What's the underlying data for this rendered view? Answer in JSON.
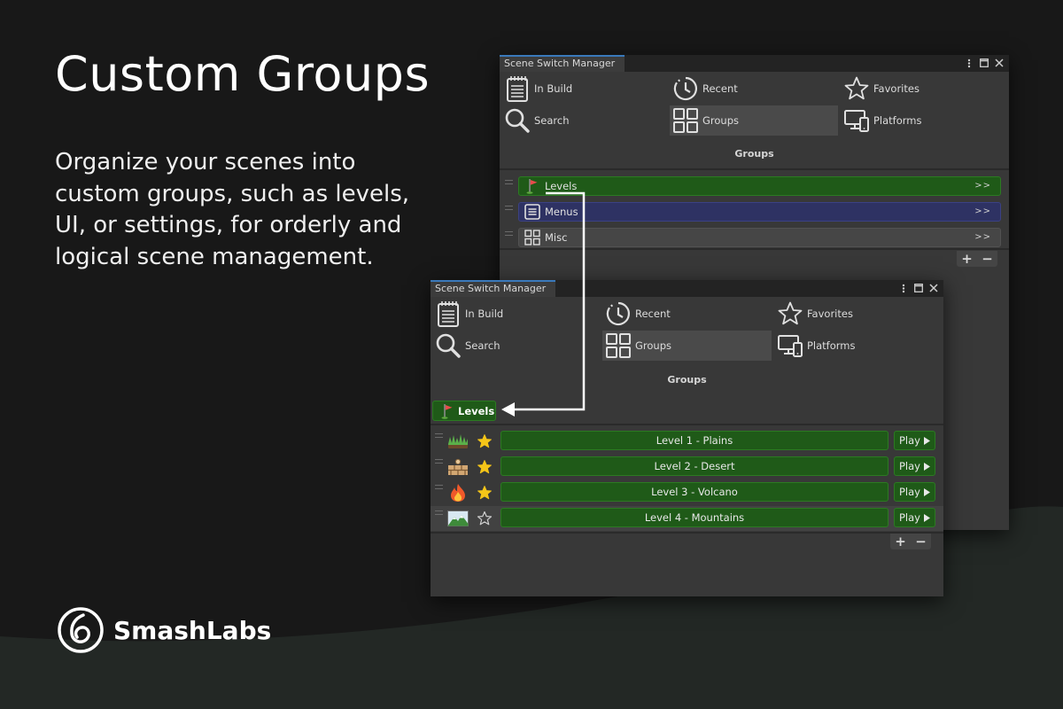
{
  "headline": "Custom Groups",
  "description": "Organize your scenes into custom groups, such as levels, UI, or settings, for orderly and logical scene management.",
  "brand": {
    "name": "SmashLabs"
  },
  "window_title": "Scene Switch Manager",
  "nav": {
    "in_build": "In Build",
    "recent": "Recent",
    "favorites": "Favorites",
    "search": "Search",
    "groups": "Groups",
    "platforms": "Platforms"
  },
  "section_title": "Groups",
  "groups": [
    {
      "label": "Levels",
      "chevron": ">>",
      "icon": "flag-icon"
    },
    {
      "label": "Menus",
      "chevron": ">>",
      "icon": "list-icon"
    },
    {
      "label": "Misc",
      "chevron": ">>",
      "icon": "grid-icon"
    }
  ],
  "plus_label": "+",
  "minus_label": "−",
  "breadcrumb": "Levels",
  "scenes": [
    {
      "name": "Level 1 - Plains",
      "favorite": true,
      "icon": "grass-icon",
      "play": "Play"
    },
    {
      "name": "Level 2 - Desert",
      "favorite": true,
      "icon": "bricks-icon",
      "play": "Play"
    },
    {
      "name": "Level 3 - Volcano",
      "favorite": true,
      "icon": "fire-icon",
      "play": "Play"
    },
    {
      "name": "Level 4 - Mountains",
      "favorite": false,
      "icon": "mountains-icon",
      "play": "Play"
    }
  ],
  "colors": {
    "background": "#181818",
    "tab_accent": "#3a79bb",
    "levels_group": "#1f5a18",
    "menus_group": "#2e3263",
    "misc_group": "#464646",
    "star_gold": "#f5c518"
  }
}
